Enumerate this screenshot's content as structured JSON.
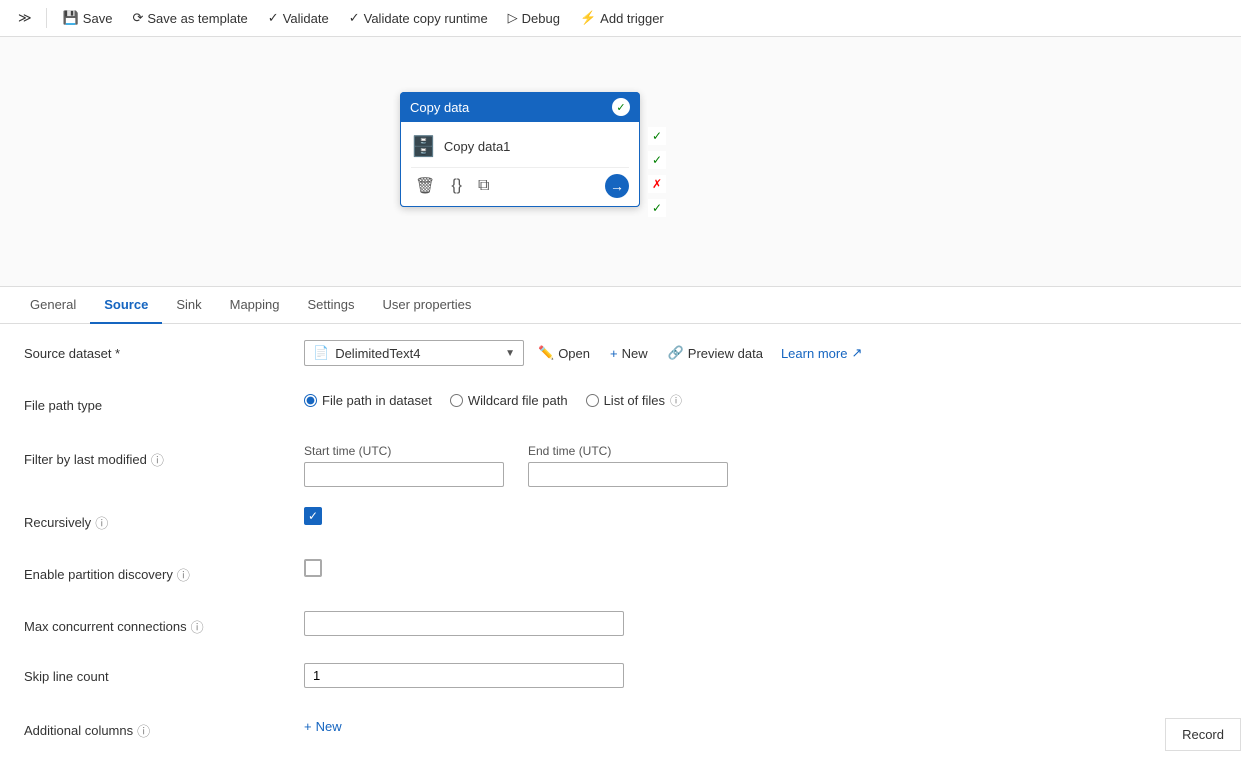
{
  "toolbar": {
    "expand_label": "≫",
    "save_label": "Save",
    "save_template_label": "Save as template",
    "validate_label": "Validate",
    "validate_runtime_label": "Validate copy runtime",
    "debug_label": "Debug",
    "add_trigger_label": "Add trigger"
  },
  "canvas": {
    "node": {
      "title": "Copy data",
      "subtitle": "Copy data1"
    }
  },
  "tabs": {
    "items": [
      {
        "label": "General",
        "id": "general"
      },
      {
        "label": "Source",
        "id": "source"
      },
      {
        "label": "Sink",
        "id": "sink"
      },
      {
        "label": "Mapping",
        "id": "mapping"
      },
      {
        "label": "Settings",
        "id": "settings"
      },
      {
        "label": "User properties",
        "id": "user-properties"
      }
    ],
    "active": "source"
  },
  "source": {
    "dataset_label": "Source dataset *",
    "dataset_value": "DelimitedText4",
    "open_label": "Open",
    "new_label": "New",
    "preview_label": "Preview data",
    "learn_more_label": "Learn more",
    "file_path_type_label": "File path type",
    "file_path_options": [
      {
        "id": "file_path_in_dataset",
        "label": "File path in dataset"
      },
      {
        "id": "wildcard_file_path",
        "label": "Wildcard file path"
      },
      {
        "id": "list_of_files",
        "label": "List of files"
      }
    ],
    "selected_file_path": "file_path_in_dataset",
    "filter_by_modified_label": "Filter by last modified",
    "start_time_label": "Start time (UTC)",
    "end_time_label": "End time (UTC)",
    "start_time_value": "",
    "end_time_value": "",
    "recursively_label": "Recursively",
    "recursively_checked": true,
    "enable_partition_label": "Enable partition discovery",
    "enable_partition_checked": false,
    "max_connections_label": "Max concurrent connections",
    "max_connections_value": "",
    "skip_line_label": "Skip line count",
    "skip_line_value": "1",
    "additional_columns_label": "Additional columns",
    "new_label2": "New",
    "record_label": "Record",
    "info_icon": "ⓘ"
  }
}
